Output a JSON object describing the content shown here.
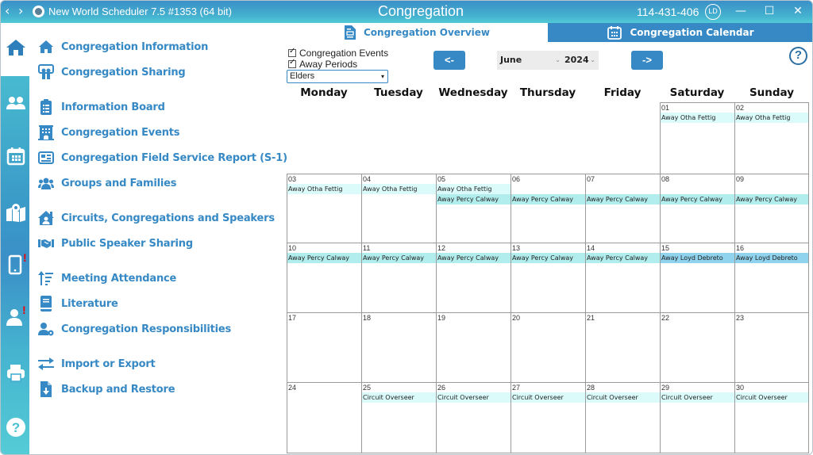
{
  "titlebar": {
    "back": "‹",
    "forward": "›",
    "app_title": "New World Scheduler 7.5 #1353 (64 bit)",
    "section_title": "Congregation",
    "congregation_code": "114-431-406",
    "user_initials": "LD",
    "minimize": "—",
    "maximize": "☐",
    "close": "✕"
  },
  "rail": {
    "items": [
      {
        "name": "home",
        "active": true
      },
      {
        "name": "people"
      },
      {
        "name": "calendar"
      },
      {
        "name": "territory-map"
      },
      {
        "name": "mobile",
        "alert": "!"
      },
      {
        "name": "person",
        "alert": "!"
      },
      {
        "name": "print"
      },
      {
        "name": "help"
      }
    ]
  },
  "menu": {
    "items": [
      {
        "label": "Congregation Information",
        "icon": "home-icon"
      },
      {
        "label": "Congregation Sharing",
        "icon": "sharing-icon"
      },
      {
        "label": "Information Board",
        "icon": "clipboard-icon"
      },
      {
        "label": "Congregation Events",
        "icon": "building-icon"
      },
      {
        "label": "Congregation Field Service Report (S-1)",
        "icon": "report-card-icon"
      },
      {
        "label": "Groups and Families",
        "icon": "groups-icon"
      },
      {
        "label": "Circuits, Congregations and Speakers",
        "icon": "house-user-icon"
      },
      {
        "label": "Public Speaker Sharing",
        "icon": "handshake-icon"
      },
      {
        "label": "Meeting Attendance",
        "icon": "attendance-icon"
      },
      {
        "label": "Literature",
        "icon": "book-icon"
      },
      {
        "label": "Congregation Responsibilities",
        "icon": "responsibilities-icon"
      },
      {
        "label": "Import or Export",
        "icon": "import-export-icon"
      },
      {
        "label": "Backup and Restore",
        "icon": "backup-icon"
      }
    ]
  },
  "tabs": {
    "overview": "Congregation Overview",
    "calendar": "Congregation Calendar",
    "active": "overview"
  },
  "filters": {
    "congregation_events": {
      "label": "Congregation Events",
      "checked": true
    },
    "away_periods": {
      "label": "Away Periods",
      "checked": true
    },
    "group_select": {
      "value": "Elders",
      "caret": "▾"
    }
  },
  "navigation": {
    "prev": "<-",
    "next": "->",
    "month": "June",
    "year": "2024",
    "caret": "⌄",
    "help": "?"
  },
  "calendar": {
    "colors": {
      "otha": "#dbfbfb",
      "percy": "#b2eded",
      "loyd": "#8fd3ee",
      "circuit": "#dbfbfb"
    },
    "weekdays": [
      "Monday",
      "Tuesday",
      "Wednesday",
      "Thursday",
      "Friday",
      "Saturday",
      "Sunday"
    ],
    "weeks": [
      [
        null,
        null,
        null,
        null,
        null,
        {
          "day": "01",
          "events": [
            {
              "text": "Away Otha Fettig",
              "color": "otha"
            }
          ]
        },
        {
          "day": "02",
          "events": [
            {
              "text": "Away Otha Fettig",
              "color": "otha"
            }
          ]
        }
      ],
      [
        {
          "day": "03",
          "events": [
            {
              "text": "Away Otha Fettig",
              "color": "otha"
            }
          ]
        },
        {
          "day": "04",
          "events": [
            {
              "text": "Away Otha Fettig",
              "color": "otha"
            }
          ]
        },
        {
          "day": "05",
          "events": [
            {
              "text": "Away Otha Fettig",
              "color": "otha"
            },
            {
              "text": "Away Percy Calway",
              "color": "percy"
            }
          ]
        },
        {
          "day": "06",
          "events": [
            {
              "text": "",
              "color": ""
            },
            {
              "text": "Away Percy Calway",
              "color": "percy"
            }
          ]
        },
        {
          "day": "07",
          "events": [
            {
              "text": "",
              "color": ""
            },
            {
              "text": "Away Percy Calway",
              "color": "percy"
            }
          ]
        },
        {
          "day": "08",
          "events": [
            {
              "text": "",
              "color": ""
            },
            {
              "text": "Away Percy Calway",
              "color": "percy"
            }
          ]
        },
        {
          "day": "09",
          "events": [
            {
              "text": "",
              "color": ""
            },
            {
              "text": "Away Percy Calway",
              "color": "percy"
            }
          ]
        }
      ],
      [
        {
          "day": "10",
          "events": [
            {
              "text": "Away Percy Calway",
              "color": "percy"
            }
          ]
        },
        {
          "day": "11",
          "events": [
            {
              "text": "Away Percy Calway",
              "color": "percy"
            }
          ]
        },
        {
          "day": "12",
          "events": [
            {
              "text": "Away Percy Calway",
              "color": "percy"
            }
          ]
        },
        {
          "day": "13",
          "events": [
            {
              "text": "Away Percy Calway",
              "color": "percy"
            }
          ]
        },
        {
          "day": "14",
          "events": [
            {
              "text": "Away Percy Calway",
              "color": "percy"
            }
          ]
        },
        {
          "day": "15",
          "events": [
            {
              "text": "Away Loyd Debreto",
              "color": "loyd"
            }
          ]
        },
        {
          "day": "16",
          "events": [
            {
              "text": "Away Loyd Debreto",
              "color": "loyd"
            }
          ]
        }
      ],
      [
        {
          "day": "17",
          "events": []
        },
        {
          "day": "18",
          "events": []
        },
        {
          "day": "19",
          "events": []
        },
        {
          "day": "20",
          "events": []
        },
        {
          "day": "21",
          "events": []
        },
        {
          "day": "22",
          "events": []
        },
        {
          "day": "23",
          "events": []
        }
      ],
      [
        {
          "day": "24",
          "events": []
        },
        {
          "day": "25",
          "events": [
            {
              "text": "Circuit Overseer",
              "color": "circuit"
            }
          ]
        },
        {
          "day": "26",
          "events": [
            {
              "text": "Circuit Overseer",
              "color": "circuit"
            }
          ]
        },
        {
          "day": "27",
          "events": [
            {
              "text": "Circuit Overseer",
              "color": "circuit"
            }
          ]
        },
        {
          "day": "28",
          "events": [
            {
              "text": "Circuit Overseer",
              "color": "circuit"
            }
          ]
        },
        {
          "day": "29",
          "events": [
            {
              "text": "Circuit Overseer",
              "color": "circuit"
            }
          ]
        },
        {
          "day": "30",
          "events": [
            {
              "text": "Circuit Overseer",
              "color": "circuit"
            }
          ]
        }
      ]
    ]
  }
}
